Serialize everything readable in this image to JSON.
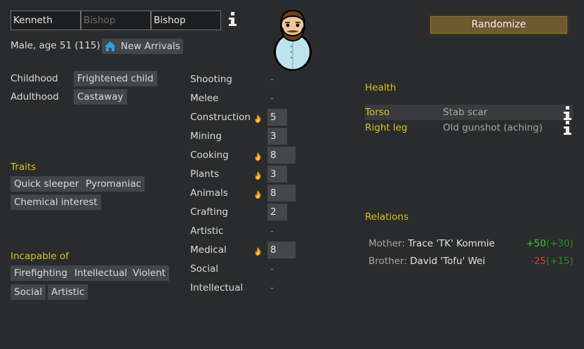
{
  "name": {
    "first": "Kenneth",
    "nick_placeholder": "Bishop",
    "last": "Bishop"
  },
  "summary": "Male, age 51 (115)",
  "faction": {
    "label": "New Arrivals",
    "icon": "house-icon"
  },
  "randomize_label": "Randomize",
  "backstory": {
    "childhood_label": "Childhood",
    "childhood_value": "Frightened child",
    "adulthood_label": "Adulthood",
    "adulthood_value": "Castaway"
  },
  "traits": {
    "title": "Traits",
    "items": [
      "Quick sleeper",
      "Pyromaniac",
      "Chemical interest"
    ]
  },
  "incapable": {
    "title": "Incapable of",
    "items": [
      "Firefighting",
      "Intellectual",
      "Violent",
      "Social",
      "Artistic"
    ]
  },
  "skills": [
    {
      "name": "Shooting",
      "level": null,
      "passion": false
    },
    {
      "name": "Melee",
      "level": null,
      "passion": false
    },
    {
      "name": "Construction",
      "level": 5,
      "passion": true
    },
    {
      "name": "Mining",
      "level": 3,
      "passion": false
    },
    {
      "name": "Cooking",
      "level": 8,
      "passion": true
    },
    {
      "name": "Plants",
      "level": 3,
      "passion": true
    },
    {
      "name": "Animals",
      "level": 8,
      "passion": true
    },
    {
      "name": "Crafting",
      "level": 2,
      "passion": false
    },
    {
      "name": "Artistic",
      "level": null,
      "passion": false
    },
    {
      "name": "Medical",
      "level": 8,
      "passion": true
    },
    {
      "name": "Social",
      "level": null,
      "passion": false
    },
    {
      "name": "Intellectual",
      "level": null,
      "passion": false
    }
  ],
  "skill_empty": "-",
  "health": {
    "title": "Health",
    "rows": [
      {
        "part": "Torso",
        "condition": "Stab scar"
      },
      {
        "part": "Right leg",
        "condition": "Old gunshot (aching)"
      }
    ]
  },
  "relations": {
    "title": "Relations",
    "rows": [
      {
        "relation": "Mother:",
        "name": "Trace 'TK' Kommie",
        "opinion": "+50",
        "their_opinion": "(+30)"
      },
      {
        "relation": "Brother:",
        "name": "David 'Tofu' Wei",
        "opinion": "-25",
        "their_opinion": "(+15)"
      }
    ]
  },
  "colors": {
    "background": "#2a2b2c",
    "section_title": "#ddc21c",
    "chip": "#434547",
    "positive": "#2fd12f",
    "negative": "#de3a3a"
  }
}
